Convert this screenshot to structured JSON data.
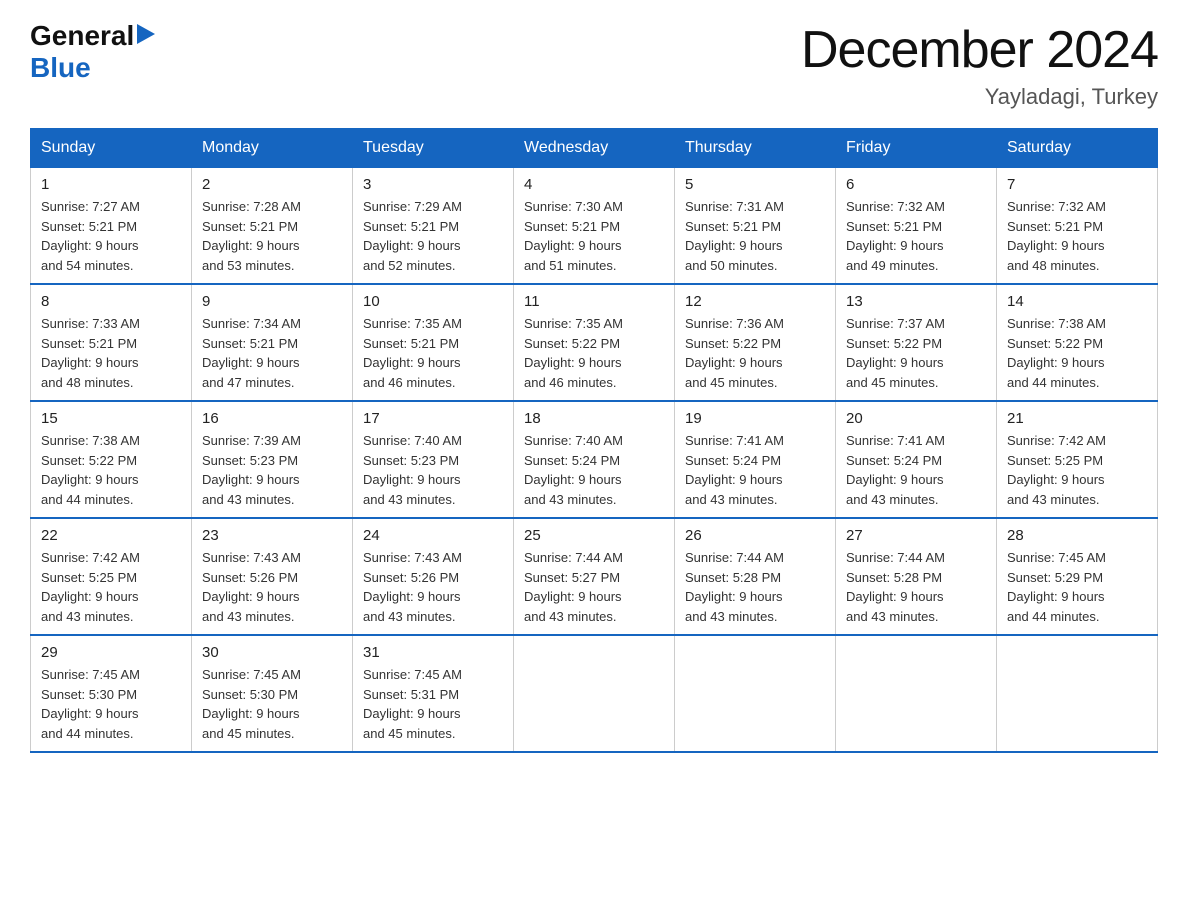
{
  "logo": {
    "general": "General",
    "blue": "Blue"
  },
  "title": "December 2024",
  "subtitle": "Yayladagi, Turkey",
  "header": {
    "days": [
      "Sunday",
      "Monday",
      "Tuesday",
      "Wednesday",
      "Thursday",
      "Friday",
      "Saturday"
    ]
  },
  "weeks": [
    [
      {
        "day": "1",
        "sunrise": "7:27 AM",
        "sunset": "5:21 PM",
        "daylight": "9 hours and 54 minutes."
      },
      {
        "day": "2",
        "sunrise": "7:28 AM",
        "sunset": "5:21 PM",
        "daylight": "9 hours and 53 minutes."
      },
      {
        "day": "3",
        "sunrise": "7:29 AM",
        "sunset": "5:21 PM",
        "daylight": "9 hours and 52 minutes."
      },
      {
        "day": "4",
        "sunrise": "7:30 AM",
        "sunset": "5:21 PM",
        "daylight": "9 hours and 51 minutes."
      },
      {
        "day": "5",
        "sunrise": "7:31 AM",
        "sunset": "5:21 PM",
        "daylight": "9 hours and 50 minutes."
      },
      {
        "day": "6",
        "sunrise": "7:32 AM",
        "sunset": "5:21 PM",
        "daylight": "9 hours and 49 minutes."
      },
      {
        "day": "7",
        "sunrise": "7:32 AM",
        "sunset": "5:21 PM",
        "daylight": "9 hours and 48 minutes."
      }
    ],
    [
      {
        "day": "8",
        "sunrise": "7:33 AM",
        "sunset": "5:21 PM",
        "daylight": "9 hours and 48 minutes."
      },
      {
        "day": "9",
        "sunrise": "7:34 AM",
        "sunset": "5:21 PM",
        "daylight": "9 hours and 47 minutes."
      },
      {
        "day": "10",
        "sunrise": "7:35 AM",
        "sunset": "5:21 PM",
        "daylight": "9 hours and 46 minutes."
      },
      {
        "day": "11",
        "sunrise": "7:35 AM",
        "sunset": "5:22 PM",
        "daylight": "9 hours and 46 minutes."
      },
      {
        "day": "12",
        "sunrise": "7:36 AM",
        "sunset": "5:22 PM",
        "daylight": "9 hours and 45 minutes."
      },
      {
        "day": "13",
        "sunrise": "7:37 AM",
        "sunset": "5:22 PM",
        "daylight": "9 hours and 45 minutes."
      },
      {
        "day": "14",
        "sunrise": "7:38 AM",
        "sunset": "5:22 PM",
        "daylight": "9 hours and 44 minutes."
      }
    ],
    [
      {
        "day": "15",
        "sunrise": "7:38 AM",
        "sunset": "5:22 PM",
        "daylight": "9 hours and 44 minutes."
      },
      {
        "day": "16",
        "sunrise": "7:39 AM",
        "sunset": "5:23 PM",
        "daylight": "9 hours and 43 minutes."
      },
      {
        "day": "17",
        "sunrise": "7:40 AM",
        "sunset": "5:23 PM",
        "daylight": "9 hours and 43 minutes."
      },
      {
        "day": "18",
        "sunrise": "7:40 AM",
        "sunset": "5:24 PM",
        "daylight": "9 hours and 43 minutes."
      },
      {
        "day": "19",
        "sunrise": "7:41 AM",
        "sunset": "5:24 PM",
        "daylight": "9 hours and 43 minutes."
      },
      {
        "day": "20",
        "sunrise": "7:41 AM",
        "sunset": "5:24 PM",
        "daylight": "9 hours and 43 minutes."
      },
      {
        "day": "21",
        "sunrise": "7:42 AM",
        "sunset": "5:25 PM",
        "daylight": "9 hours and 43 minutes."
      }
    ],
    [
      {
        "day": "22",
        "sunrise": "7:42 AM",
        "sunset": "5:25 PM",
        "daylight": "9 hours and 43 minutes."
      },
      {
        "day": "23",
        "sunrise": "7:43 AM",
        "sunset": "5:26 PM",
        "daylight": "9 hours and 43 minutes."
      },
      {
        "day": "24",
        "sunrise": "7:43 AM",
        "sunset": "5:26 PM",
        "daylight": "9 hours and 43 minutes."
      },
      {
        "day": "25",
        "sunrise": "7:44 AM",
        "sunset": "5:27 PM",
        "daylight": "9 hours and 43 minutes."
      },
      {
        "day": "26",
        "sunrise": "7:44 AM",
        "sunset": "5:28 PM",
        "daylight": "9 hours and 43 minutes."
      },
      {
        "day": "27",
        "sunrise": "7:44 AM",
        "sunset": "5:28 PM",
        "daylight": "9 hours and 43 minutes."
      },
      {
        "day": "28",
        "sunrise": "7:45 AM",
        "sunset": "5:29 PM",
        "daylight": "9 hours and 44 minutes."
      }
    ],
    [
      {
        "day": "29",
        "sunrise": "7:45 AM",
        "sunset": "5:30 PM",
        "daylight": "9 hours and 44 minutes."
      },
      {
        "day": "30",
        "sunrise": "7:45 AM",
        "sunset": "5:30 PM",
        "daylight": "9 hours and 45 minutes."
      },
      {
        "day": "31",
        "sunrise": "7:45 AM",
        "sunset": "5:31 PM",
        "daylight": "9 hours and 45 minutes."
      },
      null,
      null,
      null,
      null
    ]
  ],
  "labels": {
    "sunrise": "Sunrise:",
    "sunset": "Sunset:",
    "daylight": "Daylight:"
  }
}
